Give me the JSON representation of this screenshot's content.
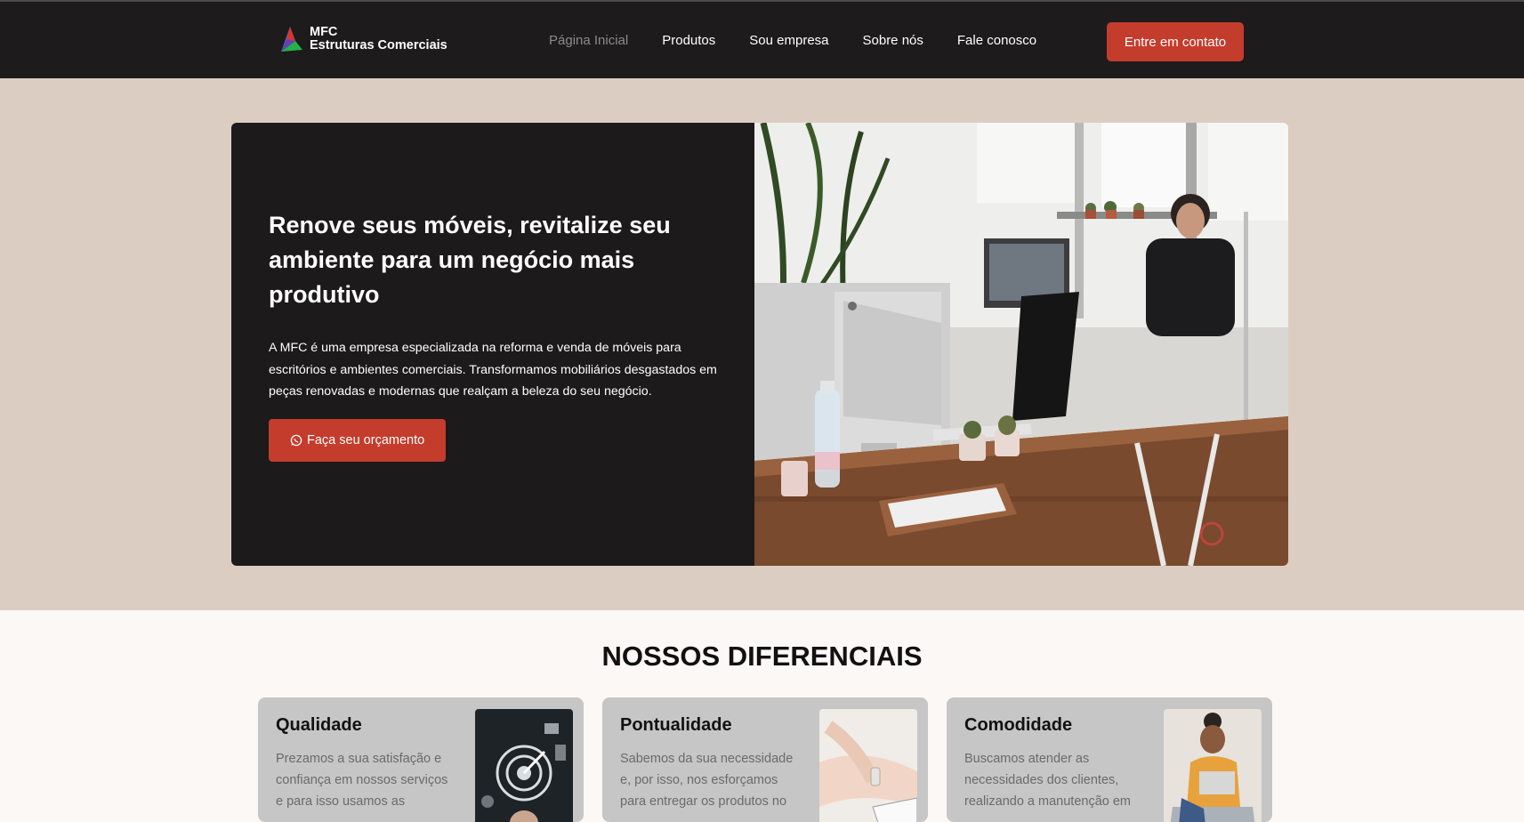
{
  "brand": {
    "line1": "MFC",
    "line2": "Estruturas Comerciais"
  },
  "nav": {
    "items": [
      "Página Inicial",
      "Produtos",
      "Sou empresa",
      "Sobre nós",
      "Fale conosco"
    ],
    "active": "Página Inicial"
  },
  "header": {
    "cta_label": "Entre em contato"
  },
  "hero": {
    "title": "Renove seus móveis, revitalize seu ambiente para um negócio mais produtivo",
    "text": "A MFC é uma empresa especializada na reforma e venda de móveis para escritórios e ambientes comerciais. Transformamos mobiliários desgastados em peças renovadas e modernas que realçam a beleza do seu negócio.",
    "button_label": "Faça seu orçamento",
    "button_icon": "whatsapp-icon"
  },
  "differentials": {
    "title": "NOSSOS DIFERENCIAIS",
    "cards": [
      {
        "title": "Qualidade",
        "text": "Prezamos a sua satisfação e confiança em nossos serviços e para isso usamos as"
      },
      {
        "title": "Pontualidade",
        "text": "Sabemos da sua necessidade e, por isso, nos esforçamos para entregar os produtos no"
      },
      {
        "title": "Comodidade",
        "text": "Buscamos atender as necessidades dos clientes, realizando a manutenção em"
      }
    ]
  },
  "colors": {
    "header_bg": "#1d1b1c",
    "accent": "#c43c2c",
    "hero_band": "#dccdc3",
    "card_bg": "#c6c6c6"
  }
}
